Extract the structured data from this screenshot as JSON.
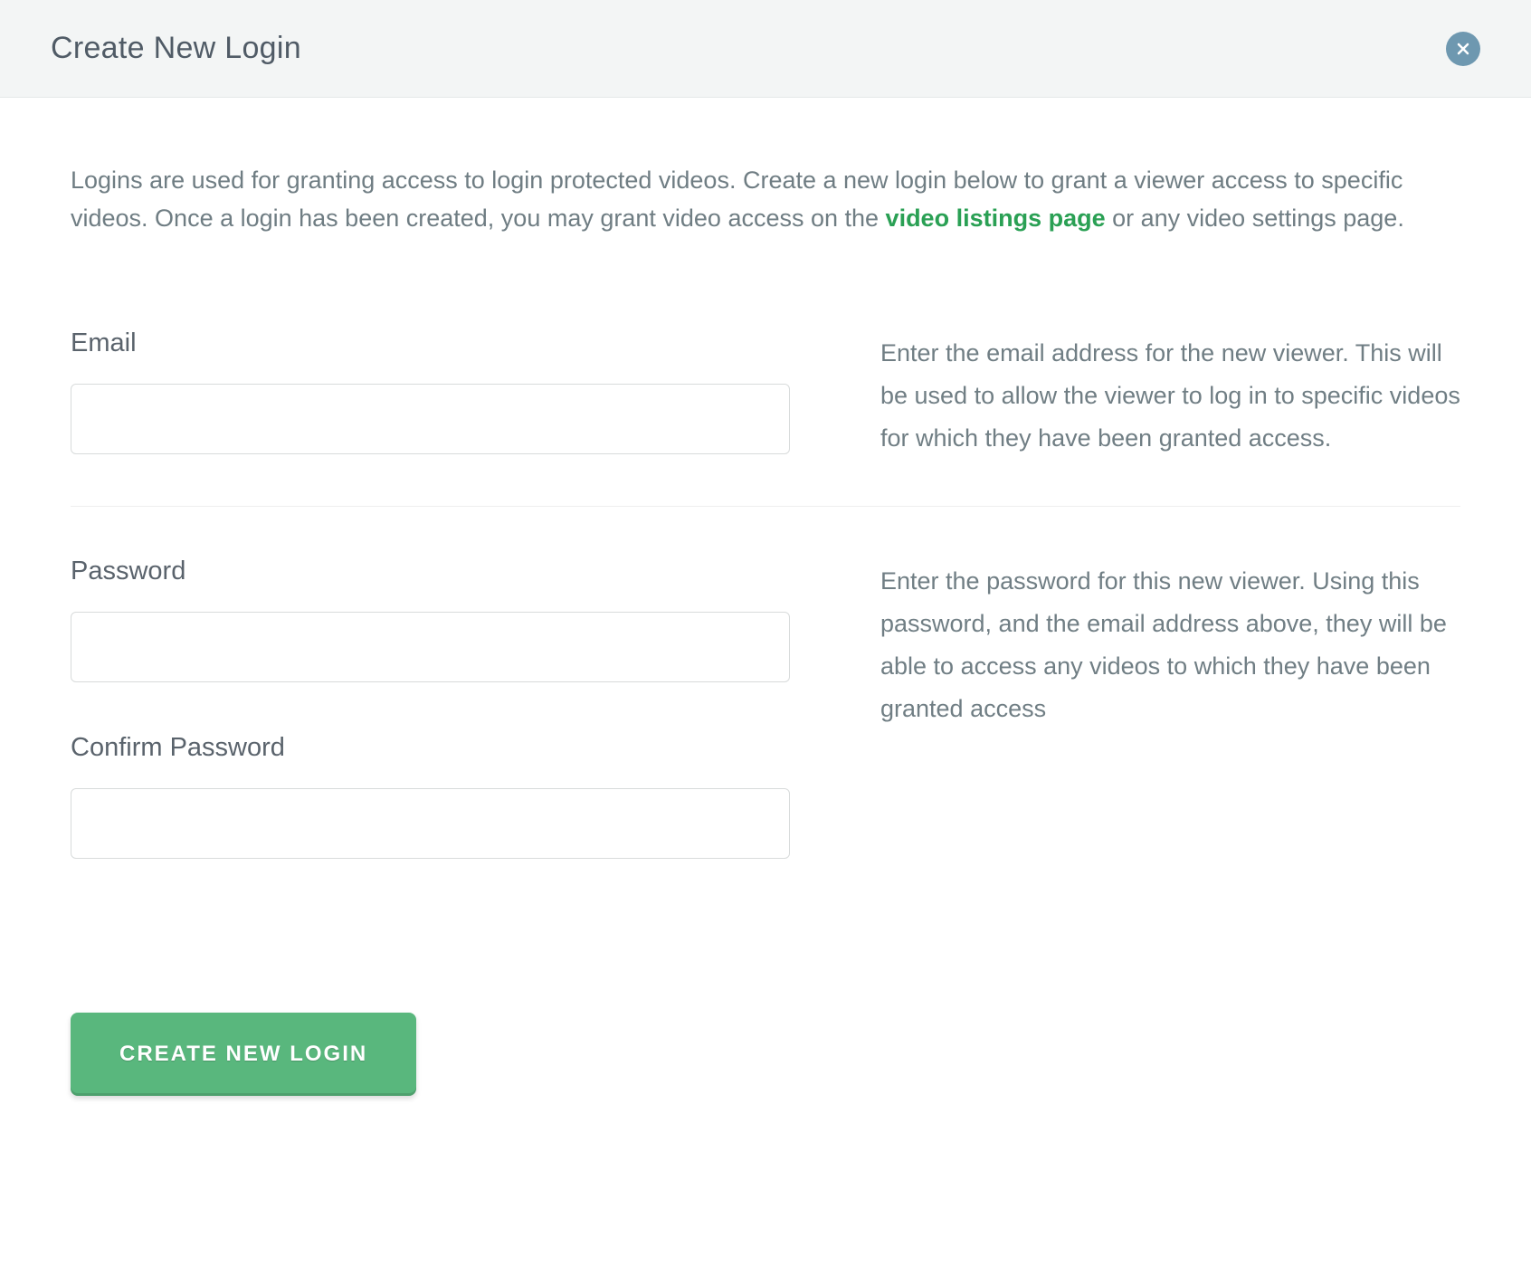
{
  "header": {
    "title": "Create New Login"
  },
  "intro": {
    "before_link": "Logins are used for granting access to login protected videos. Create a new login below to grant a viewer access to specific videos. Once a login has been created, you may grant video access on the ",
    "link_text": "video listings page",
    "after_link": " or any video settings page."
  },
  "fields": {
    "email": {
      "label": "Email",
      "value": "",
      "help": "Enter the email address for the new viewer. This will be used to allow the viewer to log in to specific videos for which they have been granted access."
    },
    "password": {
      "label": "Password",
      "value": "",
      "help": "Enter the password for this new viewer. Using this password, and the email address above, they will be able to access any videos to which they have been granted access"
    },
    "confirm_password": {
      "label": "Confirm Password",
      "value": ""
    }
  },
  "actions": {
    "submit_label": "CREATE NEW LOGIN"
  }
}
